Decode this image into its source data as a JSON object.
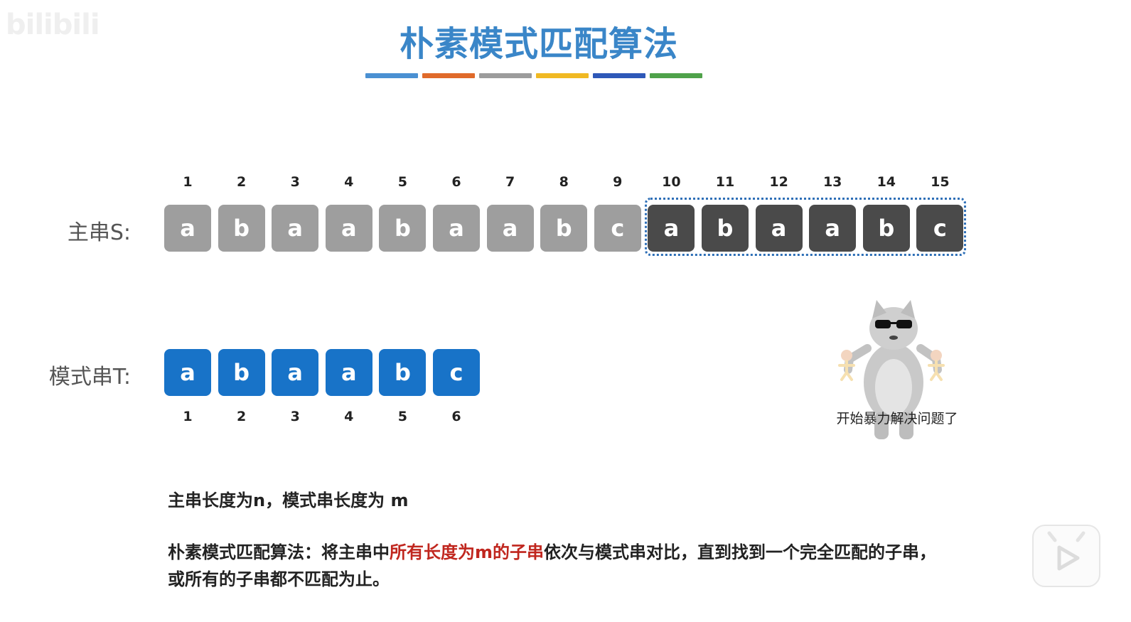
{
  "watermark": "bilibili",
  "title": "朴素模式匹配算法",
  "title_bar_colors": [
    "#4a90d2",
    "#e06a2a",
    "#9c9c9c",
    "#f0b923",
    "#2e58b8",
    "#4fa24a"
  ],
  "main_string": {
    "label": "主串S:",
    "indices": [
      "1",
      "2",
      "3",
      "4",
      "5",
      "6",
      "7",
      "8",
      "9",
      "10",
      "11",
      "12",
      "13",
      "14",
      "15"
    ],
    "chars": [
      "a",
      "b",
      "a",
      "a",
      "b",
      "a",
      "a",
      "b",
      "c",
      "a",
      "b",
      "a",
      "a",
      "b",
      "c"
    ],
    "highlighted_from": 10,
    "colors": {
      "normal": "#9e9e9e",
      "highlighted": "#4a4a4a",
      "box_border": "#2e6fb7"
    }
  },
  "pattern_string": {
    "label": "模式串T:",
    "chars": [
      "a",
      "b",
      "a",
      "a",
      "b",
      "c"
    ],
    "indices": [
      "1",
      "2",
      "3",
      "4",
      "5",
      "6"
    ],
    "color": "#1873c8"
  },
  "meme": {
    "caption": "开始暴力解决问题了"
  },
  "description": {
    "line1": "主串长度为n，模式串长度为 m",
    "line2_part1": "朴素模式匹配算法：将主串中",
    "line2_highlight": "所有长度为m的子串",
    "line2_part2": "依次与模式串对比，直到找到一个完全匹配的子串，",
    "line3": "或所有的子串都不匹配为止。",
    "highlight_color": "#c0261e"
  },
  "player": {
    "play_icon": "play-icon"
  }
}
